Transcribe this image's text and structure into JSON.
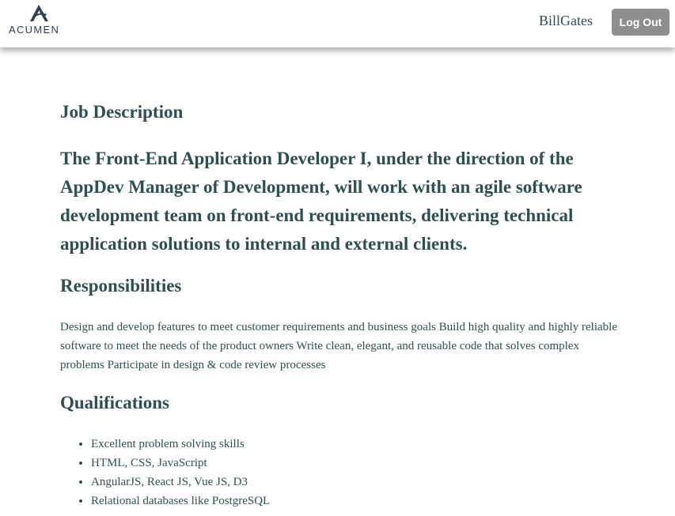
{
  "header": {
    "logo_text": "ACUMEN",
    "username": "BillGates",
    "logout_label": "Log Out"
  },
  "job": {
    "heading": "Job Description",
    "summary": "The Front-End Application Developer I, under the direction of the AppDev Manager of Development, will work with an agile software development team on front-end requirements, delivering technical application solutions to internal and external clients."
  },
  "responsibilities": {
    "heading": "Responsibilities",
    "text": "Design and develop features to meet customer requirements and business goals Build high quality and highly reliable software to meet the needs of the product owners Write clean, elegant, and reusable code that solves complex problems Participate in design & code review processes"
  },
  "qualifications": {
    "heading": "Qualifications",
    "items": [
      "Excellent problem solving skills",
      "HTML, CSS, JavaScript",
      "AngularJS, React JS, Vue JS, D3",
      "Relational databases like PostgreSQL"
    ]
  },
  "colors": {
    "text": "#2f4f4f",
    "logout_bg": "#8e8e8e",
    "logo": "#2c3e50"
  }
}
